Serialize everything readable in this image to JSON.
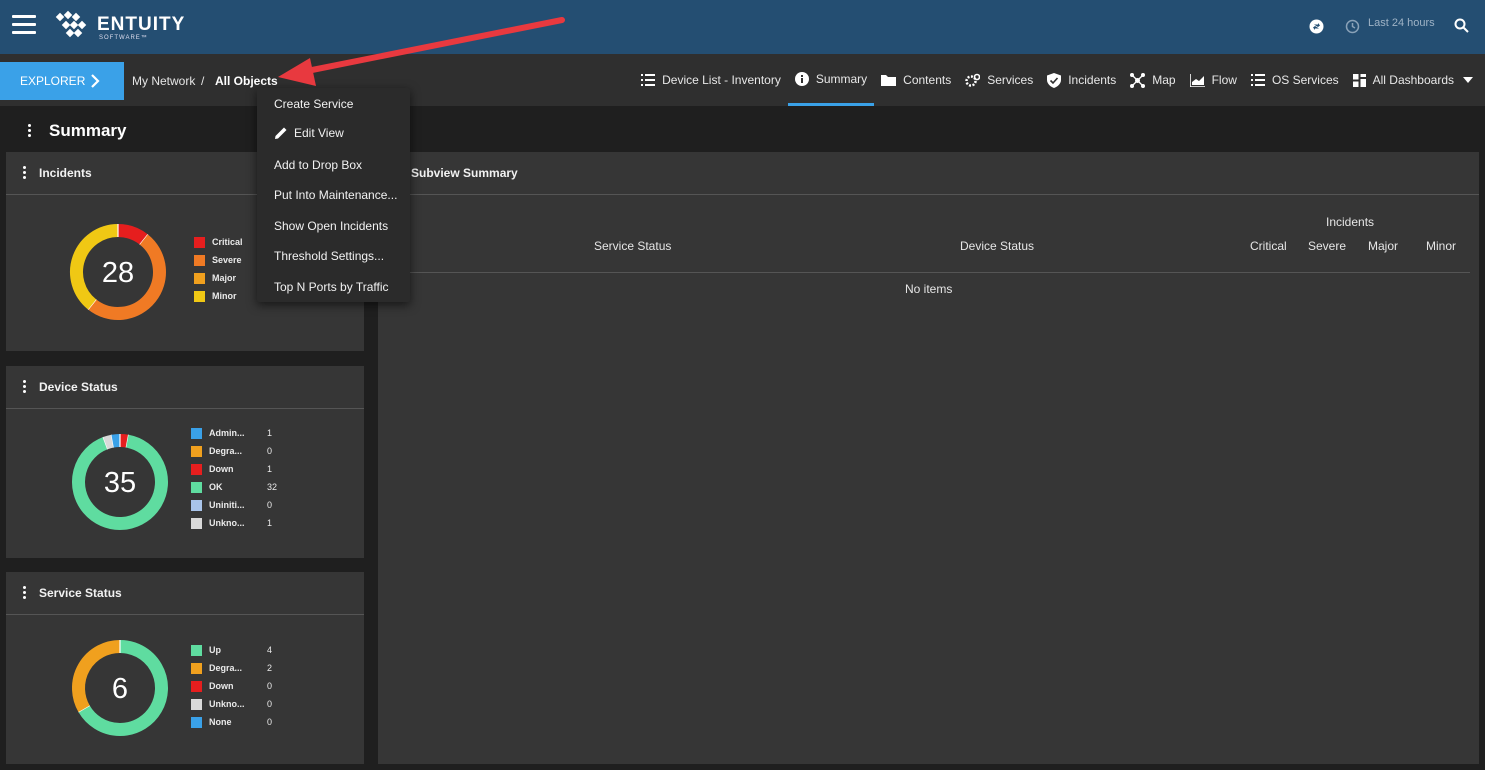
{
  "header": {
    "logo_name": "ENTUITY",
    "logo_sub": "SOFTWARE™",
    "time_range": "Last 24 hours"
  },
  "nav": {
    "explorer_label": "EXPLORER",
    "breadcrumb": [
      "My Network",
      "/",
      "All Objects"
    ],
    "tabs": [
      {
        "label": "Device List - Inventory",
        "icon": "list-icon"
      },
      {
        "label": "Summary",
        "icon": "info-icon"
      },
      {
        "label": "Contents",
        "icon": "folder-icon"
      },
      {
        "label": "Services",
        "icon": "gears-icon"
      },
      {
        "label": "Incidents",
        "icon": "shield-icon"
      },
      {
        "label": "Map",
        "icon": "network-icon"
      },
      {
        "label": "Flow",
        "icon": "chart-icon"
      },
      {
        "label": "OS Services",
        "icon": "list-icon"
      },
      {
        "label": "All Dashboards",
        "icon": "grid-icon"
      }
    ],
    "active_tab": "Summary"
  },
  "page_title": "Summary",
  "context_menu": {
    "items": [
      "Create Service",
      "Edit View",
      "Add to Drop Box",
      "Put Into Maintenance...",
      "Show Open Incidents",
      "Threshold Settings...",
      "Top N Ports by Traffic"
    ]
  },
  "incidents_panel": {
    "title": "Incidents",
    "total": "28",
    "legend": [
      {
        "label": "Critical",
        "color": "#e61e1e"
      },
      {
        "label": "Severe",
        "color": "#f07a24"
      },
      {
        "label": "Major",
        "color": "#f0a01e"
      },
      {
        "label": "Minor",
        "color": "#f0c814"
      }
    ]
  },
  "device_status_panel": {
    "title": "Device Status",
    "total": "35",
    "legend": [
      {
        "label": "Admin...",
        "count": "1",
        "color": "#3aa1e8"
      },
      {
        "label": "Degra...",
        "count": "0",
        "color": "#f0a01e"
      },
      {
        "label": "Down",
        "count": "1",
        "color": "#e61e1e"
      },
      {
        "label": "OK",
        "count": "32",
        "color": "#5fdca0"
      },
      {
        "label": "Uniniti...",
        "count": "0",
        "color": "#a9c4ea"
      },
      {
        "label": "Unkno...",
        "count": "1",
        "color": "#d9d9d9"
      }
    ]
  },
  "service_status_panel": {
    "title": "Service Status",
    "total": "6",
    "legend": [
      {
        "label": "Up",
        "count": "4",
        "color": "#5fdca0"
      },
      {
        "label": "Degra...",
        "count": "2",
        "color": "#f0a01e"
      },
      {
        "label": "Down",
        "count": "0",
        "color": "#e61e1e"
      },
      {
        "label": "Unkno...",
        "count": "0",
        "color": "#d9d9d9"
      },
      {
        "label": "None",
        "count": "0",
        "color": "#3aa1e8"
      }
    ]
  },
  "subview": {
    "title": "Subview Summary",
    "incidents_group": "Incidents",
    "columns": [
      "Service Status",
      "Device Status",
      "Critical",
      "Severe",
      "Major",
      "Minor"
    ],
    "empty_text": "No items"
  },
  "colors": {
    "topbar": "#244e72",
    "accent": "#3aa1e8",
    "arrow": "#e8393f"
  },
  "chart_data": [
    {
      "type": "pie",
      "title": "Incidents",
      "categories": [
        "Critical",
        "Severe",
        "Major",
        "Minor"
      ],
      "values": [
        3,
        14,
        0,
        11
      ]
    },
    {
      "type": "pie",
      "title": "Device Status",
      "categories": [
        "Admin...",
        "Degra...",
        "Down",
        "OK",
        "Uniniti...",
        "Unkno..."
      ],
      "values": [
        1,
        0,
        1,
        32,
        0,
        1
      ]
    },
    {
      "type": "pie",
      "title": "Service Status",
      "categories": [
        "Up",
        "Degra...",
        "Down",
        "Unkno...",
        "None"
      ],
      "values": [
        4,
        2,
        0,
        0,
        0
      ]
    }
  ]
}
